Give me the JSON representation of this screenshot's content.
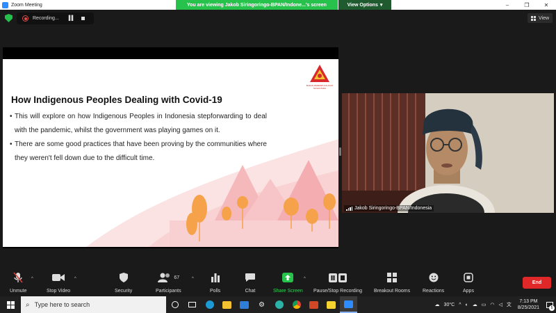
{
  "window": {
    "title": "Zoom Meeting",
    "controls": [
      "–",
      "❐",
      "✕"
    ]
  },
  "share_banner": {
    "text": "You are viewing Jakob Siringoringo-BPAN/Indone...'s screen",
    "view_options_label": "View Options",
    "view_options_caret": "▾"
  },
  "recording": {
    "label": "Recording...",
    "pause_glyph": "▌▌"
  },
  "view_button": {
    "label": "View"
  },
  "slide": {
    "logo_caption": "BADAN PEREMPUAN ADAT NUSANTARA",
    "title": "How Indigenous Peoples Dealing with Covid-19",
    "bullets": [
      "This will explore on how Indigenous Peoples in Indonesia stepforwarding to deal with the pandemic, whilst the government was playing games on it.",
      "There are some good practices that have been proving by the communities  where they weren't fell down due to the difficult time."
    ]
  },
  "video": {
    "participant_name": "Jakob Siringoringo-BPAN/Indonesia"
  },
  "toolbar": {
    "unmute": "Unmute",
    "stop_video": "Stop Video",
    "security": "Security",
    "participants": "Participants",
    "participants_count": "67",
    "polls": "Polls",
    "chat": "Chat",
    "share_screen": "Share Screen",
    "pause_stop_recording": "Pause/Stop Recording",
    "breakout_rooms": "Breakout Rooms",
    "reactions": "Reactions",
    "apps": "Apps",
    "end": "End",
    "caret": "^"
  },
  "taskbar": {
    "search_placeholder": "Type here to search",
    "weather": "30°C",
    "time": "7:13 PM",
    "date": "8/25/2021",
    "notification_count": "5"
  },
  "colors": {
    "share_green": "#26c24b",
    "end_red": "#e02828",
    "slide_pink": "#f7c5c8",
    "slide_orange": "#f6a24a"
  }
}
